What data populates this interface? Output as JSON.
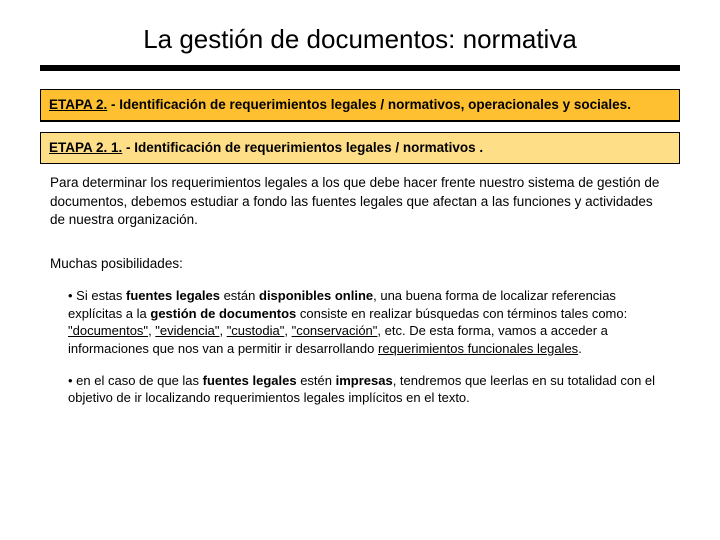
{
  "title": "La gestión de documentos: normativa",
  "box1": {
    "lead": "ETAPA 2.",
    "rest": " - Identificación de requerimientos legales / normativos, operacionales y sociales."
  },
  "box2": {
    "lead": "ETAPA 2. 1.",
    "rest": " - Identificación de requerimientos legales / normativos ."
  },
  "para1": "Para determinar los requerimientos legales a los que debe hacer frente nuestro sistema de gestión de documentos, debemos estudiar a fondo las fuentes legales que afectan a las funciones y actividades de nuestra organización.",
  "para2": "Muchas posibilidades:",
  "bullet1_html": "• Si estas <b>fuentes legales</b> están <b>disponibles online</b>, una buena forma de localizar referencias explícitas a la <b>gestión de documentos</b> consiste en realizar búsquedas con términos tales como: <u>\"documentos\"</u>, <u>\"evidencia\"</u>, <u>\"custodia\"</u>, <u>\"conservación\"</u>, etc. De esta forma, vamos a acceder a informaciones que nos van a permitir ir desarrollando <u>requerimientos funcionales legales</u>.",
  "bullet2_html": "• en el caso de que las <b>fuentes legales</b> estén <b>impresas</b>, tendremos que leerlas en su totalidad con el objetivo de ir localizando requerimientos legales implícitos en el texto."
}
